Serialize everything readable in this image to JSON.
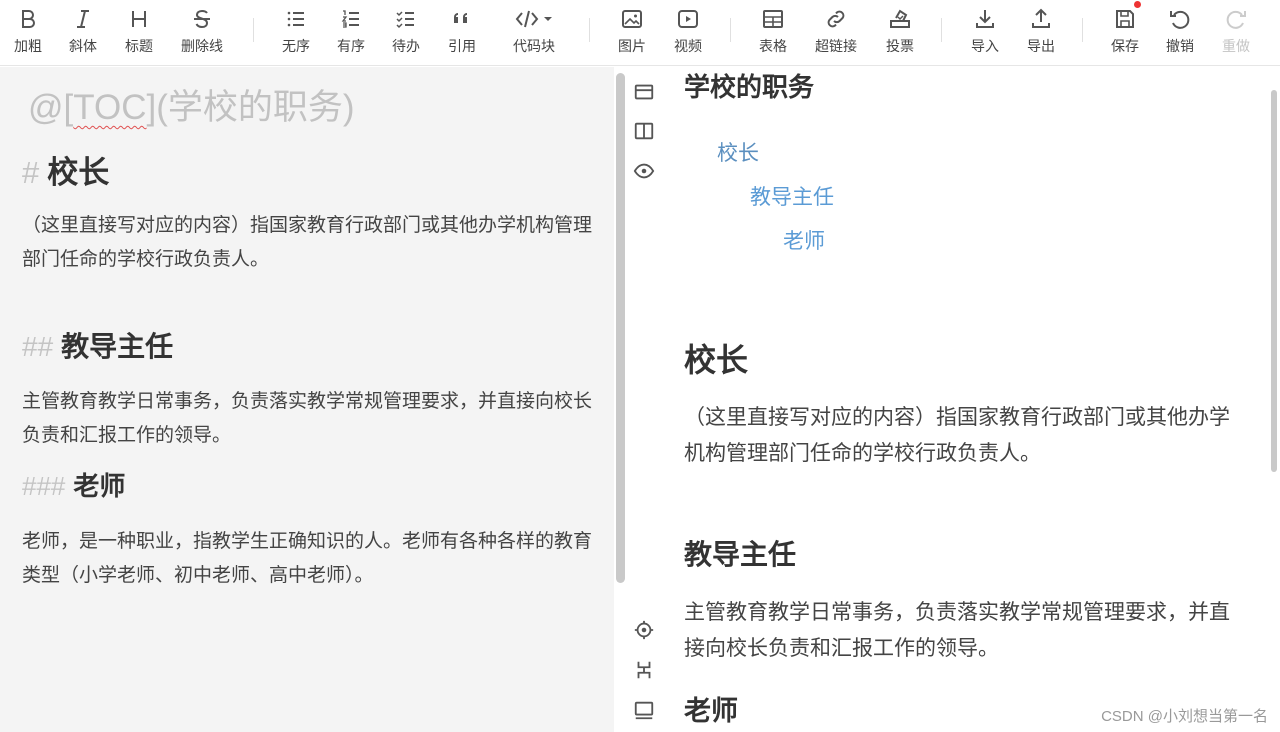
{
  "toolbar": {
    "bold": "加粗",
    "italic": "斜体",
    "heading": "标题",
    "strike": "删除线",
    "ul": "无序",
    "ol": "有序",
    "todo": "待办",
    "quote": "引用",
    "code": "代码块",
    "image": "图片",
    "video": "视频",
    "table": "表格",
    "link": "超链接",
    "vote": "投票",
    "import": "导入",
    "export": "导出",
    "save": "保存",
    "undo": "撤销",
    "redo": "重做"
  },
  "editor": {
    "toc": "@[TOC](学校的职务)",
    "toc_prefix": "@[",
    "toc_word": "TOC",
    "toc_suffix": "](学校的职务)",
    "h1_mark": "#",
    "h1": "校长",
    "p1": "（这里直接写对应的内容）指国家教育行政部门或其他办学机构管理部门任命的学校行政负责人。",
    "h2_mark": "##",
    "h2": "教导主任",
    "p2": "主管教育教学日常事务，负责落实教学常规管理要求，并直接向校长负责和汇报工作的领导。",
    "h3_mark": "###",
    "h3": "老师",
    "p3": "老师，是一种职业，指教学生正确知识的人。老师有各种各样的教育类型（小学老师、初中老师、高中老师）。"
  },
  "preview": {
    "title": "学校的职务",
    "toc": [
      "校长",
      "教导主任",
      "老师"
    ],
    "h1": "校长",
    "p1": "（这里直接写对应的内容）指国家教育行政部门或其他办学机构管理部门任命的学校行政负责人。",
    "h2": "教导主任",
    "p2": "主管教育教学日常事务，负责落实教学常规管理要求，并直接向校长负责和汇报工作的领导。",
    "h3": "老师"
  },
  "watermark": "CSDN @小刘想当第一名",
  "colors": {
    "link": "#5b9bd5",
    "editor_bg": "#f4f4f4",
    "save_dot": "#e33333"
  }
}
